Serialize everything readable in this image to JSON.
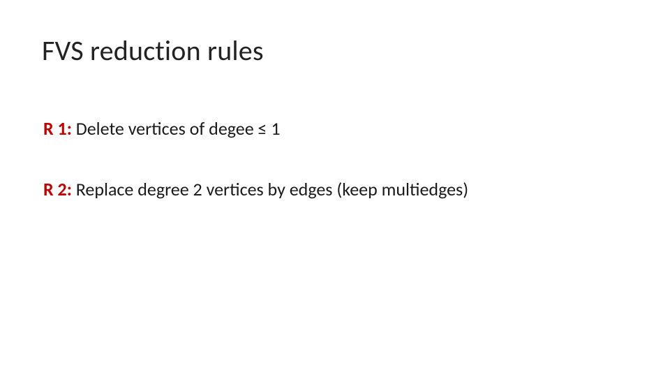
{
  "title": "FVS reduction rules",
  "rules": [
    {
      "label": "R 1:",
      "text": " Delete vertices of degee ≤ 1"
    },
    {
      "label": "R 2:",
      "text": " Replace degree 2 vertices by edges (keep multiedges)"
    }
  ]
}
